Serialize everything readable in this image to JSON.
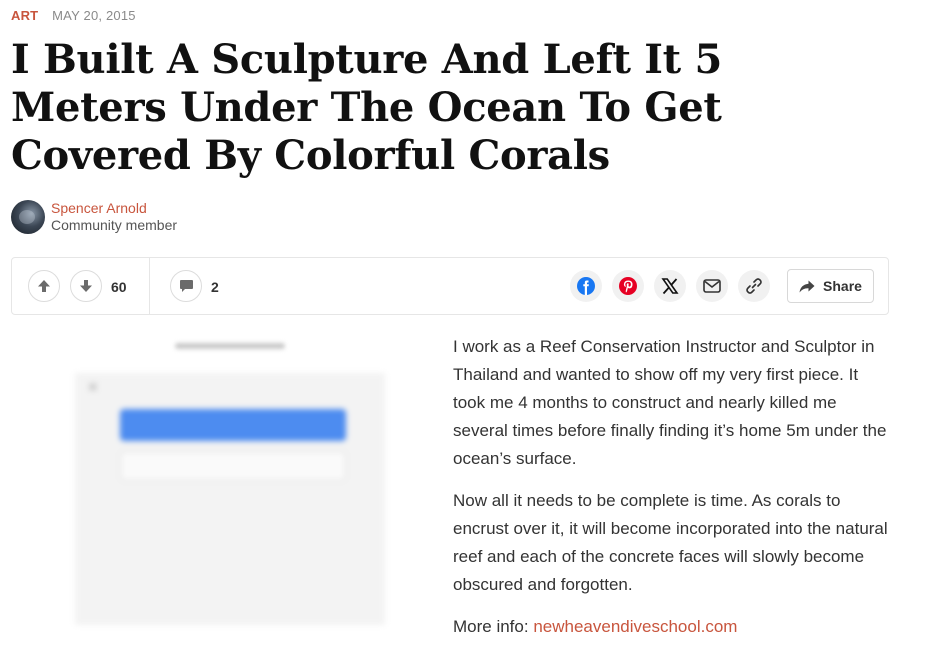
{
  "meta": {
    "category": "ART",
    "date": "MAY 20, 2015"
  },
  "article": {
    "title": "I Built A Sculpture And Left It 5 Meters Under The Ocean To Get Covered By Colorful Corals",
    "author_name": "Spencer Arnold",
    "author_role": "Community member",
    "paragraphs": [
      "I work as a Reef Conservation Instructor and Sculptor in Thailand and wanted to show off my very first piece. It took me 4 months to construct and nearly killed me several times before finally finding it’s home 5m under the ocean’s surface.",
      "Now all it needs to be complete is time. As corals to encrust over it, it will become incorporated into the natural reef and each of the concrete faces will slowly become obscured and forgotten."
    ],
    "more_info_label": "More info: ",
    "more_info_link": "newheavendiveschool.com"
  },
  "actions": {
    "vote_count": "60",
    "comment_count": "2",
    "share_label": "Share",
    "icons": {
      "upvote": "arrow-up-icon",
      "downvote": "arrow-down-icon",
      "comment": "speech-bubble-icon",
      "facebook": "facebook-icon",
      "pinterest": "pinterest-icon",
      "x": "x-icon",
      "email": "envelope-icon",
      "copy_link": "link-icon",
      "share": "share-arrow-icon"
    }
  },
  "colors": {
    "accent": "#c8553d",
    "facebook": "#1877f2",
    "pinterest": "#e60023"
  }
}
